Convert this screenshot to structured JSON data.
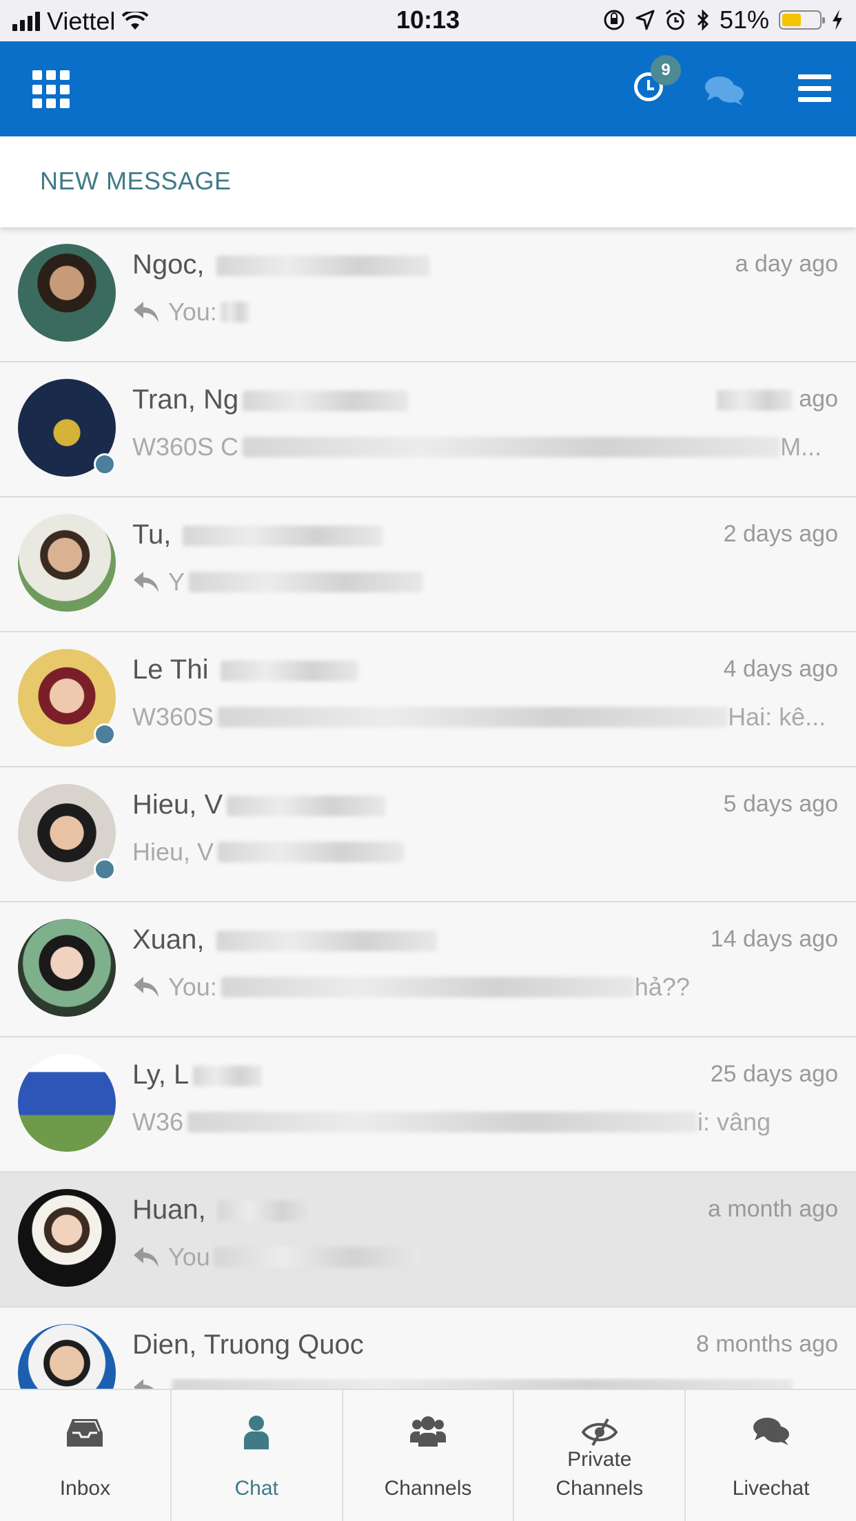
{
  "status_bar": {
    "carrier": "Viettel",
    "time": "10:13",
    "battery_percent": "51%",
    "battery_level": 0.51
  },
  "header": {
    "notification_count": "9",
    "icons": [
      "apps-grid-icon",
      "history-clock-icon",
      "chat-bubbles-icon",
      "menu-icon"
    ]
  },
  "new_message": {
    "label": "NEW MESSAGE"
  },
  "conversations": [
    {
      "name": "Ngoc, ",
      "time": "a day ago",
      "reply": true,
      "preview": "You:",
      "preview_suffix": "",
      "online": false
    },
    {
      "name": "Tran, Ng",
      "time": "ago",
      "reply": false,
      "preview": "W360S C",
      "preview_suffix": "M...",
      "online": true
    },
    {
      "name": "Tu, ",
      "time": "2 days ago",
      "reply": true,
      "preview": "Y",
      "preview_suffix": "",
      "online": false
    },
    {
      "name": "Le Thi ",
      "time": "4 days ago",
      "reply": false,
      "preview": "W360S",
      "preview_suffix": "Hai: kê...",
      "online": true
    },
    {
      "name": "Hieu, V",
      "time": "5 days ago",
      "reply": false,
      "preview": "Hieu, V",
      "preview_suffix": "",
      "online": true
    },
    {
      "name": "Xuan, ",
      "time": "14 days ago",
      "reply": true,
      "preview": "You:",
      "preview_suffix": "hả??",
      "online": false
    },
    {
      "name": "Ly, L",
      "time": "25 days ago",
      "reply": false,
      "preview": "W36",
      "preview_suffix": "i: vâng",
      "online": false
    },
    {
      "name": "Huan, ",
      "time": "a month ago",
      "reply": true,
      "preview": "You",
      "preview_suffix": "",
      "online": false
    },
    {
      "name": "Dien, Truong Quoc",
      "time": "8 months ago",
      "reply": true,
      "preview": "",
      "preview_suffix": "",
      "online": false
    }
  ],
  "tabs": [
    {
      "label": "Inbox",
      "icon": "inbox-icon",
      "active": false
    },
    {
      "label": "Chat",
      "icon": "user-icon",
      "active": true
    },
    {
      "label": "Channels",
      "icon": "users-group-icon",
      "active": false
    },
    {
      "label": "Private\nChannels",
      "icon": "eye-slash-icon",
      "active": false
    },
    {
      "label": "Livechat",
      "icon": "chat-bubbles-icon",
      "active": false
    }
  ],
  "colors": {
    "header_bg": "#0a6fc8",
    "accent": "#3f7a86",
    "presence": "#4b7f9a",
    "badge": "#4d8a94"
  }
}
